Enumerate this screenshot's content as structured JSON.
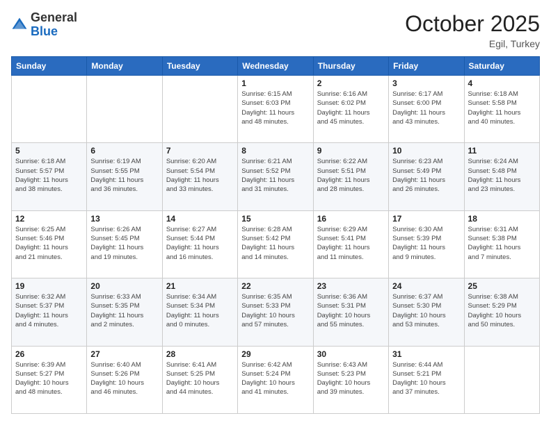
{
  "header": {
    "logo_general": "General",
    "logo_blue": "Blue",
    "month_title": "October 2025",
    "location": "Egil, Turkey"
  },
  "days_of_week": [
    "Sunday",
    "Monday",
    "Tuesday",
    "Wednesday",
    "Thursday",
    "Friday",
    "Saturday"
  ],
  "weeks": [
    [
      {
        "day": "",
        "info": ""
      },
      {
        "day": "",
        "info": ""
      },
      {
        "day": "",
        "info": ""
      },
      {
        "day": "1",
        "info": "Sunrise: 6:15 AM\nSunset: 6:03 PM\nDaylight: 11 hours\nand 48 minutes."
      },
      {
        "day": "2",
        "info": "Sunrise: 6:16 AM\nSunset: 6:02 PM\nDaylight: 11 hours\nand 45 minutes."
      },
      {
        "day": "3",
        "info": "Sunrise: 6:17 AM\nSunset: 6:00 PM\nDaylight: 11 hours\nand 43 minutes."
      },
      {
        "day": "4",
        "info": "Sunrise: 6:18 AM\nSunset: 5:58 PM\nDaylight: 11 hours\nand 40 minutes."
      }
    ],
    [
      {
        "day": "5",
        "info": "Sunrise: 6:18 AM\nSunset: 5:57 PM\nDaylight: 11 hours\nand 38 minutes."
      },
      {
        "day": "6",
        "info": "Sunrise: 6:19 AM\nSunset: 5:55 PM\nDaylight: 11 hours\nand 36 minutes."
      },
      {
        "day": "7",
        "info": "Sunrise: 6:20 AM\nSunset: 5:54 PM\nDaylight: 11 hours\nand 33 minutes."
      },
      {
        "day": "8",
        "info": "Sunrise: 6:21 AM\nSunset: 5:52 PM\nDaylight: 11 hours\nand 31 minutes."
      },
      {
        "day": "9",
        "info": "Sunrise: 6:22 AM\nSunset: 5:51 PM\nDaylight: 11 hours\nand 28 minutes."
      },
      {
        "day": "10",
        "info": "Sunrise: 6:23 AM\nSunset: 5:49 PM\nDaylight: 11 hours\nand 26 minutes."
      },
      {
        "day": "11",
        "info": "Sunrise: 6:24 AM\nSunset: 5:48 PM\nDaylight: 11 hours\nand 23 minutes."
      }
    ],
    [
      {
        "day": "12",
        "info": "Sunrise: 6:25 AM\nSunset: 5:46 PM\nDaylight: 11 hours\nand 21 minutes."
      },
      {
        "day": "13",
        "info": "Sunrise: 6:26 AM\nSunset: 5:45 PM\nDaylight: 11 hours\nand 19 minutes."
      },
      {
        "day": "14",
        "info": "Sunrise: 6:27 AM\nSunset: 5:44 PM\nDaylight: 11 hours\nand 16 minutes."
      },
      {
        "day": "15",
        "info": "Sunrise: 6:28 AM\nSunset: 5:42 PM\nDaylight: 11 hours\nand 14 minutes."
      },
      {
        "day": "16",
        "info": "Sunrise: 6:29 AM\nSunset: 5:41 PM\nDaylight: 11 hours\nand 11 minutes."
      },
      {
        "day": "17",
        "info": "Sunrise: 6:30 AM\nSunset: 5:39 PM\nDaylight: 11 hours\nand 9 minutes."
      },
      {
        "day": "18",
        "info": "Sunrise: 6:31 AM\nSunset: 5:38 PM\nDaylight: 11 hours\nand 7 minutes."
      }
    ],
    [
      {
        "day": "19",
        "info": "Sunrise: 6:32 AM\nSunset: 5:37 PM\nDaylight: 11 hours\nand 4 minutes."
      },
      {
        "day": "20",
        "info": "Sunrise: 6:33 AM\nSunset: 5:35 PM\nDaylight: 11 hours\nand 2 minutes."
      },
      {
        "day": "21",
        "info": "Sunrise: 6:34 AM\nSunset: 5:34 PM\nDaylight: 11 hours\nand 0 minutes."
      },
      {
        "day": "22",
        "info": "Sunrise: 6:35 AM\nSunset: 5:33 PM\nDaylight: 10 hours\nand 57 minutes."
      },
      {
        "day": "23",
        "info": "Sunrise: 6:36 AM\nSunset: 5:31 PM\nDaylight: 10 hours\nand 55 minutes."
      },
      {
        "day": "24",
        "info": "Sunrise: 6:37 AM\nSunset: 5:30 PM\nDaylight: 10 hours\nand 53 minutes."
      },
      {
        "day": "25",
        "info": "Sunrise: 6:38 AM\nSunset: 5:29 PM\nDaylight: 10 hours\nand 50 minutes."
      }
    ],
    [
      {
        "day": "26",
        "info": "Sunrise: 6:39 AM\nSunset: 5:27 PM\nDaylight: 10 hours\nand 48 minutes."
      },
      {
        "day": "27",
        "info": "Sunrise: 6:40 AM\nSunset: 5:26 PM\nDaylight: 10 hours\nand 46 minutes."
      },
      {
        "day": "28",
        "info": "Sunrise: 6:41 AM\nSunset: 5:25 PM\nDaylight: 10 hours\nand 44 minutes."
      },
      {
        "day": "29",
        "info": "Sunrise: 6:42 AM\nSunset: 5:24 PM\nDaylight: 10 hours\nand 41 minutes."
      },
      {
        "day": "30",
        "info": "Sunrise: 6:43 AM\nSunset: 5:23 PM\nDaylight: 10 hours\nand 39 minutes."
      },
      {
        "day": "31",
        "info": "Sunrise: 6:44 AM\nSunset: 5:21 PM\nDaylight: 10 hours\nand 37 minutes."
      },
      {
        "day": "",
        "info": ""
      }
    ]
  ]
}
